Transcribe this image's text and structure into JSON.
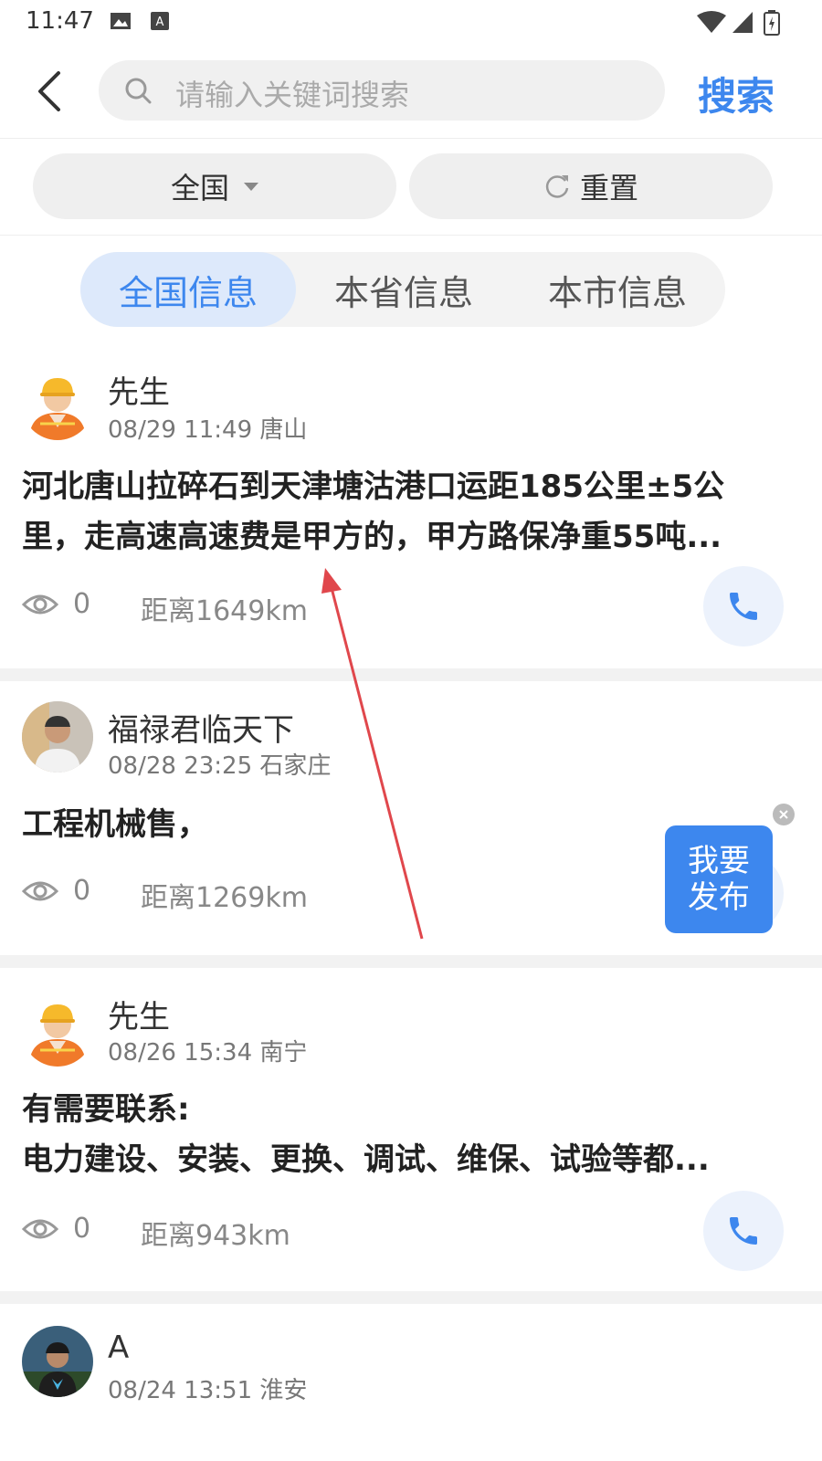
{
  "status_bar": {
    "time": "11:47"
  },
  "search": {
    "placeholder": "请输入关键词搜索",
    "button_label": "搜索"
  },
  "filters": {
    "region_label": "全国",
    "reset_label": "重置"
  },
  "tabs": [
    {
      "label": "全国信息",
      "active": true
    },
    {
      "label": "本省信息",
      "active": false
    },
    {
      "label": "本市信息",
      "active": false
    }
  ],
  "posts": [
    {
      "name": "先生",
      "meta": "08/29 11:49 唐山",
      "body_lines": [
        "河北唐山拉碎石到天津塘沽港口运距185公里±5公",
        "里，走高速高速费是甲方的，甲方路保净重55吨..."
      ],
      "views": "0",
      "distance": "距离1649km",
      "avatar": "worker-avatar"
    },
    {
      "name": "福禄君临天下",
      "meta": "08/28 23:25 石家庄",
      "body_lines": [
        "工程机械售，"
      ],
      "views": "0",
      "distance": "距离1269km",
      "avatar": "photo-avatar"
    },
    {
      "name": "先生",
      "meta": "08/26 15:34 南宁",
      "body_lines": [
        "有需要联系:",
        "电力建设、安装、更换、调试、维保、试验等都..."
      ],
      "views": "0",
      "distance": "距离943km",
      "avatar": "worker-avatar"
    },
    {
      "name": "A",
      "meta": "08/24 13:51 淮安",
      "avatar": "photo-avatar"
    }
  ],
  "publish_button": {
    "line1": "我要",
    "line2": "发布"
  },
  "colors": {
    "accent": "#3d87ee",
    "annotation_arrow": "#e0474c"
  }
}
